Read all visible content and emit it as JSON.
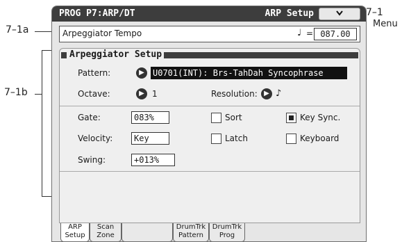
{
  "callouts": {
    "label_7_1": "7–1",
    "label_menu": "Menu",
    "label_7_1a": "7–1a",
    "label_7_1b": "7–1b"
  },
  "header": {
    "mode_title": "PROG P7:ARP/DT",
    "page_title": "ARP Setup",
    "menu_button_icon": "chevron-down-icon"
  },
  "tempo": {
    "label": "Arpeggiator Tempo",
    "note_symbol": "♩",
    "equals": "=",
    "value": "087.00"
  },
  "setup": {
    "section_title": "Arpeggiator Setup",
    "pattern_label": "Pattern:",
    "pattern_value": "U0701(INT): Brs-TahDah Syncophrase",
    "octave_label": "Octave:",
    "octave_value": "1",
    "resolution_label": "Resolution:",
    "resolution_value": "♪",
    "gate_label": "Gate:",
    "gate_value": "083%",
    "velocity_label": "Velocity:",
    "velocity_value": "Key",
    "swing_label": "Swing:",
    "swing_value": "+013%",
    "sort_label": "Sort",
    "sort_checked": false,
    "latch_label": "Latch",
    "latch_checked": false,
    "key_sync_label": "Key Sync.",
    "key_sync_checked": true,
    "keyboard_label": "Keyboard",
    "keyboard_checked": false
  },
  "tabs": [
    {
      "line1": "ARP",
      "line2": "Setup",
      "active": true
    },
    {
      "line1": "Scan",
      "line2": "Zone",
      "active": false
    },
    {
      "line1": "",
      "line2": "",
      "active": false
    },
    {
      "line1": "DrumTrk",
      "line2": "Pattern",
      "active": false
    },
    {
      "line1": "DrumTrk",
      "line2": "Prog",
      "active": false
    }
  ]
}
